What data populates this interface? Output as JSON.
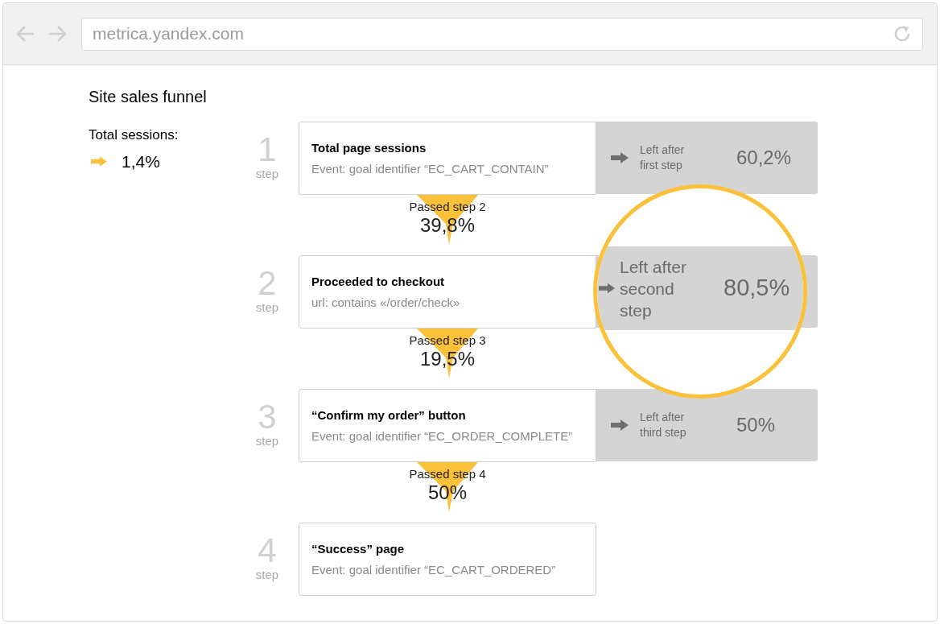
{
  "browser": {
    "address": "metrica.yandex.com"
  },
  "title": "Site sales funnel",
  "total": {
    "label": "Total sessions:",
    "value": "1,4%"
  },
  "steps": [
    {
      "number": "1",
      "unit": "step",
      "title": "Total page sessions",
      "detail": "Event: goal identifier “EC_CART_CONTAIN”",
      "left": {
        "label": "Left after first step",
        "value": "60,2%",
        "magnified": false
      }
    },
    {
      "passed": {
        "label": "Passed step 2",
        "value": "39,8%"
      },
      "number": "2",
      "unit": "step",
      "title": "Proceeded to checkout",
      "detail": "url: contains «/order/check»",
      "left": {
        "label": "Left after second step",
        "value": "80,5%",
        "magnified": true
      }
    },
    {
      "passed": {
        "label": "Passed step 3",
        "value": "19,5%"
      },
      "number": "3",
      "unit": "step",
      "title": "“Confirm my order” button",
      "detail": "Event: goal identifier “EC_ORDER_COMPLETE”",
      "left": {
        "label": "Left after third step",
        "value": "50%",
        "magnified": false
      }
    },
    {
      "passed": {
        "label": "Passed step 4",
        "value": "50%"
      },
      "number": "4",
      "unit": "step",
      "title": "“Success” page",
      "detail": "Event: goal identifier “EC_CART_ORDERED”"
    }
  ]
}
